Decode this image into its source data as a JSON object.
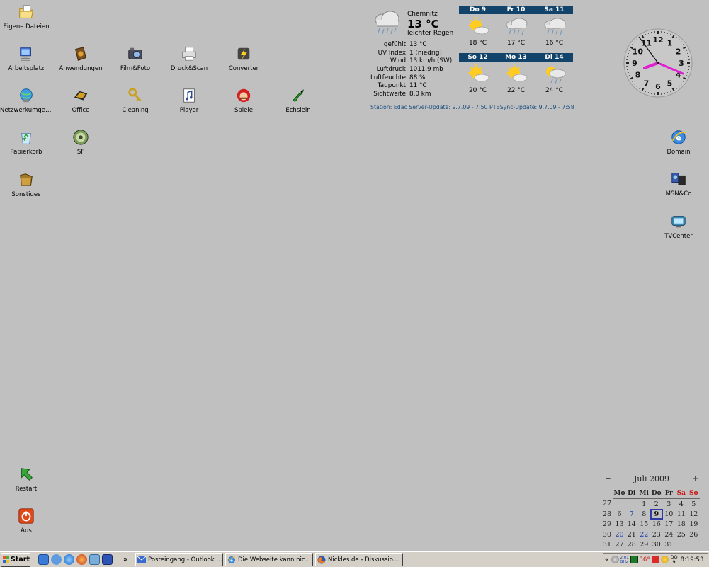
{
  "desktop": {
    "left_icons": [
      {
        "label": "Eigene Dateien",
        "icon": "folder-documents-icon"
      },
      {
        "label": "Arbeitsplatz",
        "icon": "my-computer-icon"
      },
      {
        "label": "Anwendungen",
        "icon": "applications-folder-icon"
      },
      {
        "label": "Film&Foto",
        "icon": "camera-icon"
      },
      {
        "label": "Druck&Scan",
        "icon": "printer-icon"
      },
      {
        "label": "Converter",
        "icon": "lightning-icon"
      },
      {
        "label": "Netzwerkumgeb...",
        "icon": "network-icon"
      },
      {
        "label": "Office",
        "icon": "office-icon"
      },
      {
        "label": "Cleaning",
        "icon": "keys-icon"
      },
      {
        "label": "Player",
        "icon": "music-icon"
      },
      {
        "label": "Spiele",
        "icon": "mario-icon"
      },
      {
        "label": "Echslein",
        "icon": "lizard-icon"
      },
      {
        "label": "Papierkorb",
        "icon": "recycle-bin-icon"
      },
      {
        "label": "SF",
        "icon": "disc-icon"
      },
      {
        "label": "Sonstiges",
        "icon": "folder-misc-icon"
      },
      {
        "label": "Restart",
        "icon": "restart-arrow-icon"
      },
      {
        "label": "Aus",
        "icon": "power-off-icon"
      }
    ],
    "right_icons": [
      {
        "label": "Domain",
        "icon": "internet-explorer-icon"
      },
      {
        "label": "MSN&Co",
        "icon": "msn-icon"
      },
      {
        "label": "TVCenter",
        "icon": "tv-icon"
      }
    ]
  },
  "weather": {
    "city": "Chemnitz",
    "temp": "13 °C",
    "condition": "leichter Regen",
    "details": [
      {
        "k": "gefühlt:",
        "v": "13 °C"
      },
      {
        "k": "UV Index:",
        "v": "1 (niedrig)"
      },
      {
        "k": "Wind:",
        "v": "13 km/h (SW)"
      },
      {
        "k": "Luftdruck:",
        "v": "1011.9 mb"
      },
      {
        "k": "Luftfeuchte:",
        "v": "88 %"
      },
      {
        "k": "Taupunkt:",
        "v": "11 °C"
      },
      {
        "k": "Sichtweite:",
        "v": "8.0 km"
      }
    ],
    "forecast": [
      {
        "day": "Do 9",
        "temp": "18 °C",
        "icon": "sun-cloud-icon"
      },
      {
        "day": "Fr 10",
        "temp": "17 °C",
        "icon": "rain-cloud-icon"
      },
      {
        "day": "Sa 11",
        "temp": "16 °C",
        "icon": "rain-cloud-icon"
      },
      {
        "day": "So 12",
        "temp": "20 °C",
        "icon": "sun-cloud-icon"
      },
      {
        "day": "Mo 13",
        "temp": "22 °C",
        "icon": "sun-cloud-icon"
      },
      {
        "day": "Di 14",
        "temp": "24 °C",
        "icon": "sun-rain-icon"
      }
    ],
    "station": "Station: Edac  Server-Update: 9.7.09 - 7:50  PTBSync-Update: 9.7.09 - 7:58"
  },
  "clock": {
    "time": "8:19:53",
    "numbers": [
      "12",
      "1",
      "2",
      "3",
      "4",
      "5",
      "6",
      "7",
      "8",
      "9",
      "10",
      "11"
    ]
  },
  "calendar": {
    "prev": "−",
    "next": "+",
    "month": "Juli 2009",
    "day_headers": [
      "Mo",
      "Di",
      "Mi",
      "Do",
      "Fr",
      "Sa",
      "So"
    ],
    "weeks": [
      {
        "wk": "27",
        "days": [
          "",
          "",
          "1",
          "2",
          "3",
          "4",
          "5"
        ]
      },
      {
        "wk": "28",
        "days": [
          "6",
          "7",
          "8",
          "9",
          "10",
          "11",
          "12"
        ]
      },
      {
        "wk": "29",
        "days": [
          "13",
          "14",
          "15",
          "16",
          "17",
          "18",
          "19"
        ]
      },
      {
        "wk": "30",
        "days": [
          "20",
          "21",
          "22",
          "23",
          "24",
          "25",
          "26"
        ]
      },
      {
        "wk": "31",
        "days": [
          "27",
          "28",
          "29",
          "30",
          "31",
          "",
          ""
        ]
      }
    ],
    "today": "9",
    "highlighted": [
      "7",
      "20",
      "22"
    ]
  },
  "taskbar": {
    "start_label": "Start",
    "chevron": "»",
    "tasks": [
      {
        "label": "Posteingang - Outlook E...",
        "icon": "outlook-icon"
      },
      {
        "label": "Die Webseite kann nicht ...",
        "icon": "internet-explorer-icon"
      },
      {
        "label": "Nickles.de - Diskussion: ...",
        "icon": "firefox-icon"
      }
    ],
    "tray": {
      "chevron": "«",
      "cpu": "2.01 GHz",
      "temp": "36°",
      "day": "DO",
      "date": "9",
      "time": "8:19:53"
    }
  },
  "colors": {
    "desktop": "#c0c0c0",
    "forecast_header": "#12446b",
    "clock_hands": "#e020d0",
    "weekend": "#cc1111"
  }
}
